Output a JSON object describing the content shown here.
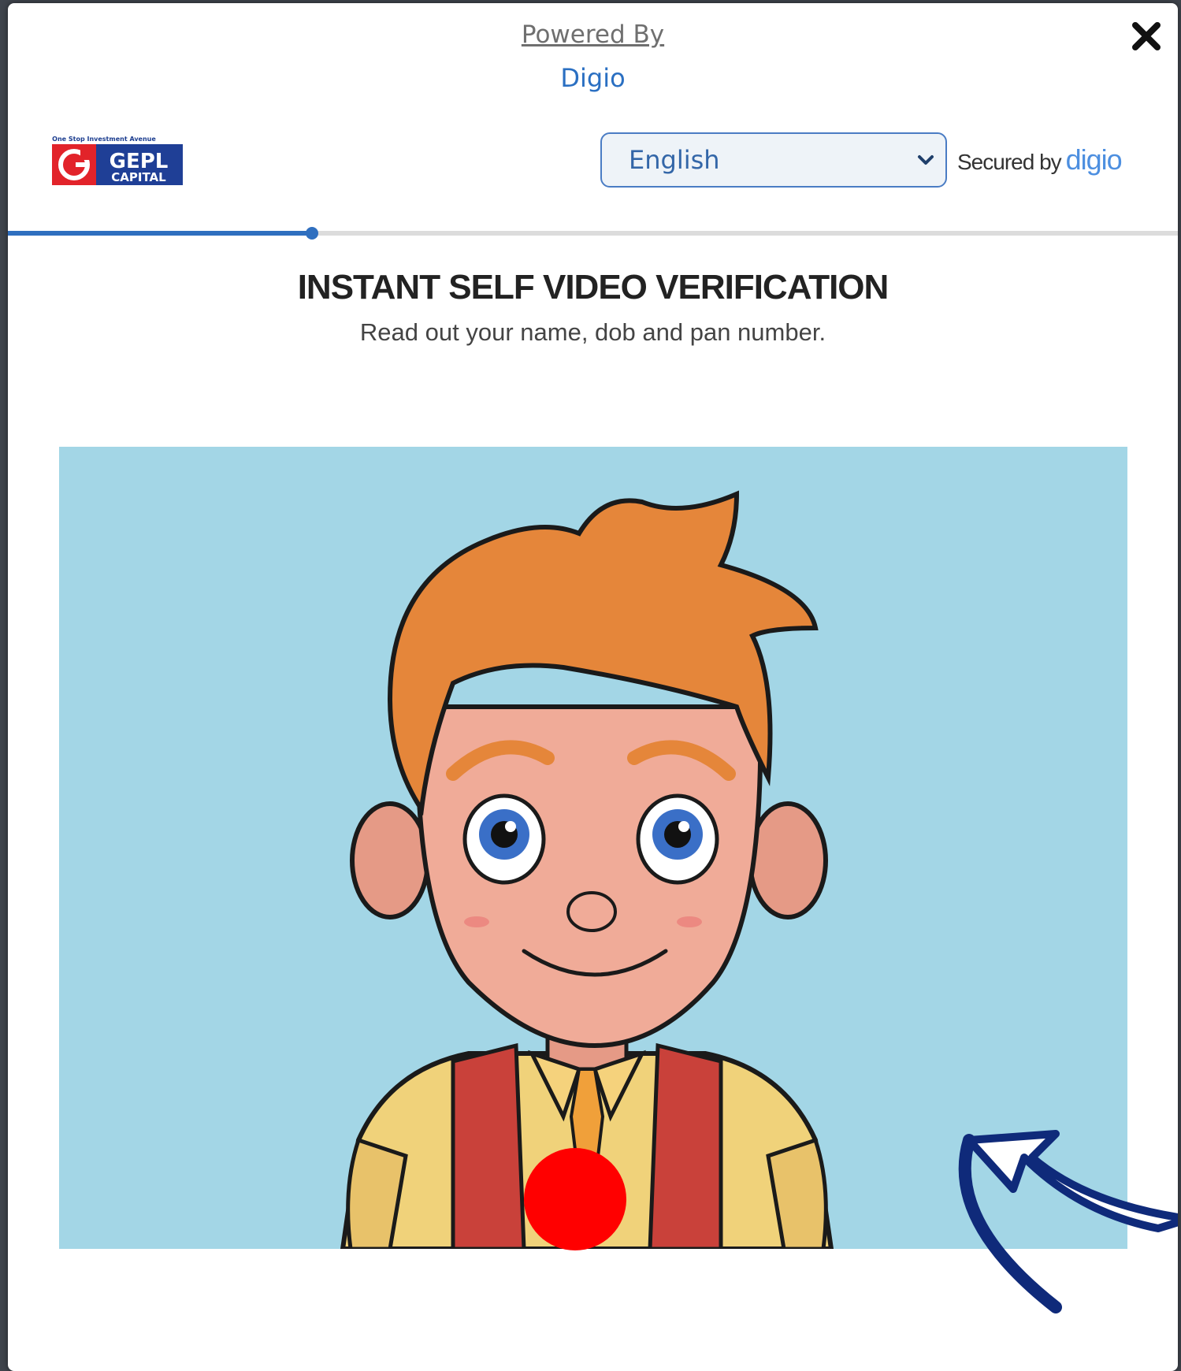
{
  "header": {
    "powered_by": "Powered By",
    "provider_link": "Digio"
  },
  "logo": {
    "tagline": "One Stop Investment Avenue",
    "name": "GEPL",
    "sub": "CAPITAL"
  },
  "language": {
    "selected": "English"
  },
  "secured": {
    "label": "Secured by",
    "brand": "digio"
  },
  "progress": {
    "fraction": 0.26
  },
  "main": {
    "title": "INSTANT SELF VIDEO VERIFICATION",
    "instruction": "Read out your name, dob and pan number."
  },
  "colors": {
    "accent": "#2f6fbf",
    "record": "#ff0000",
    "video_bg": "#a3d6e6"
  },
  "icons": {
    "close": "close-icon",
    "chevron": "chevron-down-icon",
    "record": "record-icon",
    "arrow": "arrow-icon"
  }
}
